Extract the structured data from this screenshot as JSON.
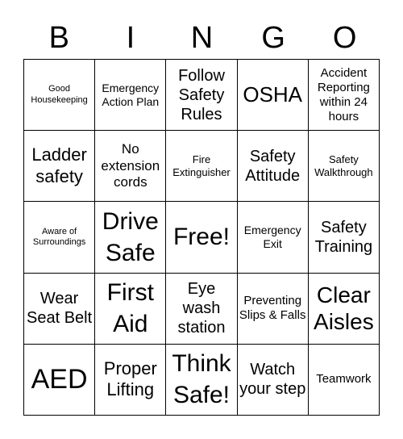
{
  "header": [
    "B",
    "I",
    "N",
    "G",
    "O"
  ],
  "cells": [
    [
      "Good Housekeeping",
      "Emergency Action Plan",
      "Follow Safety Rules",
      "OSHA",
      "Accident Reporting within 24 hours"
    ],
    [
      "Ladder safety",
      "No extension cords",
      "Fire Extinguisher",
      "Safety Attitude",
      "Safety Walkthrough"
    ],
    [
      "Aware of Surroundings",
      "Drive Safe",
      "Free!",
      "Emergency Exit",
      "Safety Training"
    ],
    [
      "Wear Seat Belt",
      "First Aid",
      "Eye wash station",
      "Preventing Slips & Falls",
      "Clear Aisles"
    ],
    [
      "AED",
      "Proper Lifting",
      "Think Safe!",
      "Watch your step",
      "Teamwork"
    ]
  ]
}
